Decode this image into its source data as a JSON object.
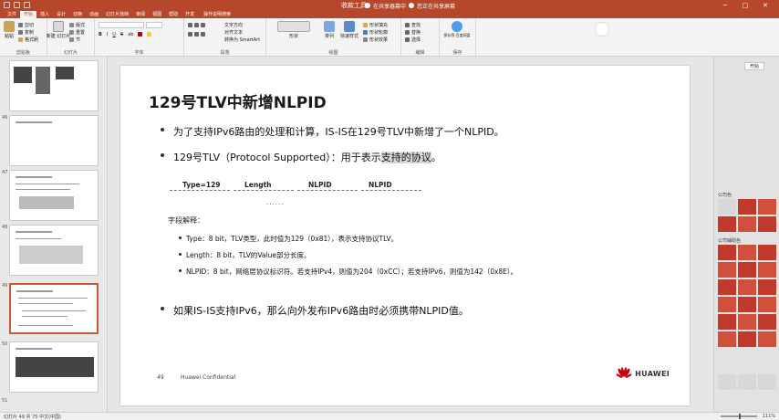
{
  "window": {
    "title": "收款工具",
    "notice": "您正在共享屏幕",
    "notice2": "在共享器幕中",
    "controls": [
      "─",
      "□",
      "✕"
    ]
  },
  "ribbon": {
    "tabs": [
      "文件",
      "开始",
      "插入",
      "设计",
      "切换",
      "动画",
      "幻灯片放映",
      "审阅",
      "视图",
      "帮助",
      "开发"
    ],
    "active_tab": "开始",
    "search_hint": "操作说明搜索",
    "groups": {
      "clipboard": {
        "label": "剪贴板",
        "paste": "粘贴",
        "cut": "剪切",
        "copy": "复制",
        "painter": "格式刷"
      },
      "slides": {
        "label": "幻灯片",
        "new_slide": "新建\n幻灯片",
        "layout": "版式",
        "reset": "重置",
        "section": "节"
      },
      "font": {
        "label": "字体",
        "bold": "B",
        "italic": "I",
        "underline": "U",
        "strike": "S",
        "shadow": "ab"
      },
      "paragraph": {
        "label": "段落",
        "text_dir": "文字方向",
        "align_text": "对齐文本",
        "smartart": "转换为 SmartArt"
      },
      "drawing": {
        "label": "绘图",
        "shapes": "形状",
        "arrange": "排列",
        "quick_styles": "快速样式",
        "fill": "形状填充",
        "outline": "形状轮廓",
        "effects": "形状效果"
      },
      "editing": {
        "label": "编辑",
        "find": "查找",
        "replace": "替换",
        "select": "选择"
      },
      "save": {
        "label": "保存",
        "save_to": "保存到\n百度网盘"
      }
    }
  },
  "thumbnails": [
    {
      "num": "",
      "selected": false
    },
    {
      "num": "46",
      "selected": false
    },
    {
      "num": "47",
      "selected": false
    },
    {
      "num": "48",
      "selected": false
    },
    {
      "num": "49",
      "selected": true
    },
    {
      "num": "50",
      "selected": false
    },
    {
      "num": "51",
      "selected": false
    }
  ],
  "slide": {
    "title": "129号TLV中新增NLPID",
    "bullet1": "为了支持IPv6路由的处理和计算，IS-IS在129号TLV中新增了一个NLPID。",
    "bullet2_prefix": "129号TLV（Protocol Supported）：用于表示",
    "bullet2_highlight": "支持的协议",
    "bullet2_suffix": "。",
    "fields": [
      "Type=129",
      "Length",
      "NLPID",
      "NLPID"
    ],
    "field_dots": "......",
    "desc_title": "字段解释：",
    "sub1": "Type：8 bit，TLV类型，此时值为129（0x81），表示支持协议TLV。",
    "sub2": "Length：8 bit，TLV的Value部分长度。",
    "sub3": "NLPID：8 bit，网络层协议标识符。若支持IPv4，则值为204（0xCC）；若支持IPv6，则值为142（0x8E）。",
    "bullet3": "如果IS-IS支持IPv6，那么向外发布IPv6路由时必须携带NLPID值。",
    "page_num": "49",
    "confidential": "Huawei Confidential",
    "logo_text": "HUAWEI"
  },
  "right_panel": {
    "button": "开始",
    "label1": "公司色",
    "label2": "公司辅助色",
    "tiles": [
      "",
      "",
      "",
      "",
      "",
      "",
      "",
      "",
      "",
      "",
      "",
      ""
    ]
  },
  "status": {
    "left": "幻灯片 49 共 75  中文(中国)",
    "zoom": "111%"
  },
  "colors": {
    "accent": "#b7472a",
    "huawei_red": "#c7000b",
    "tile_red": "#c0392b"
  }
}
